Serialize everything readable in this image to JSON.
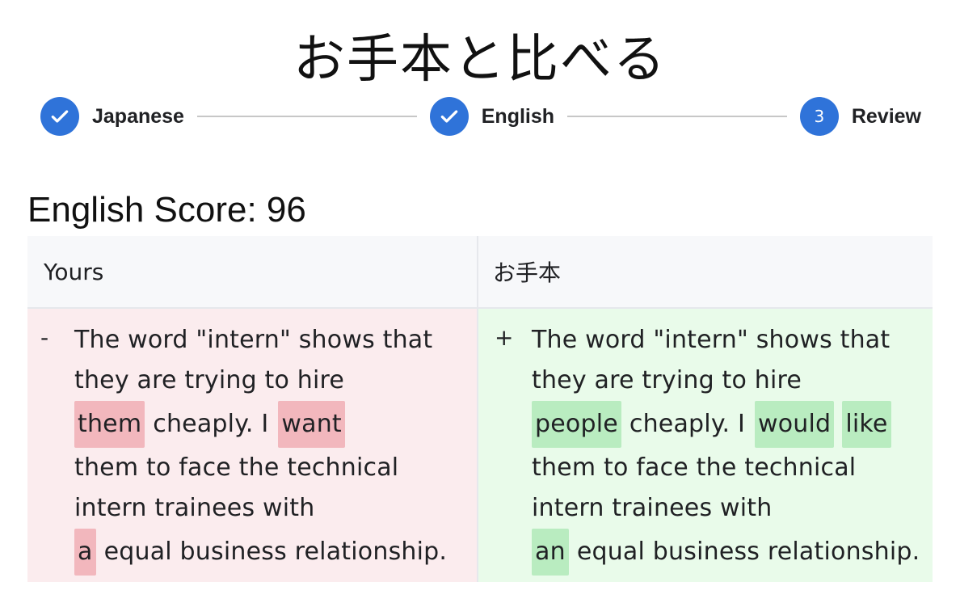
{
  "page": {
    "title": "お手本と比べる"
  },
  "stepper": {
    "steps": [
      {
        "label": "Japanese",
        "state": "done",
        "icon": "check-icon"
      },
      {
        "label": "English",
        "state": "done",
        "icon": "check-icon"
      },
      {
        "label": "Review",
        "state": "current",
        "number": "3"
      }
    ],
    "accent": "#2f73d9"
  },
  "score": {
    "label": "English Score: 96"
  },
  "diff": {
    "headers": {
      "yours": "Yours",
      "model": "お手本"
    },
    "yours": {
      "sign": "-",
      "line1": "The word \"intern\" shows that",
      "line2": "they are trying to hire",
      "hl1": "them",
      "mid1": "cheaply. I",
      "hl2": "want",
      "line4": "them to face the technical",
      "line5": "intern trainees with",
      "hl3": "a",
      "end": "equal business relationship."
    },
    "model": {
      "sign": "+",
      "line1": "The word \"intern\" shows that",
      "line2": "they are trying to hire",
      "hl1": "people",
      "mid1": "cheaply. I",
      "hl2": "would",
      "hl2b": "like",
      "line4": "them to face the technical",
      "line5": "intern trainees with",
      "hl3": "an",
      "end": "equal business relationship."
    },
    "colors": {
      "removed_bg": "#fbecee",
      "removed_highlight": "#f2b7bd",
      "added_bg": "#e9fbea",
      "added_highlight": "#b9ecc0"
    }
  }
}
